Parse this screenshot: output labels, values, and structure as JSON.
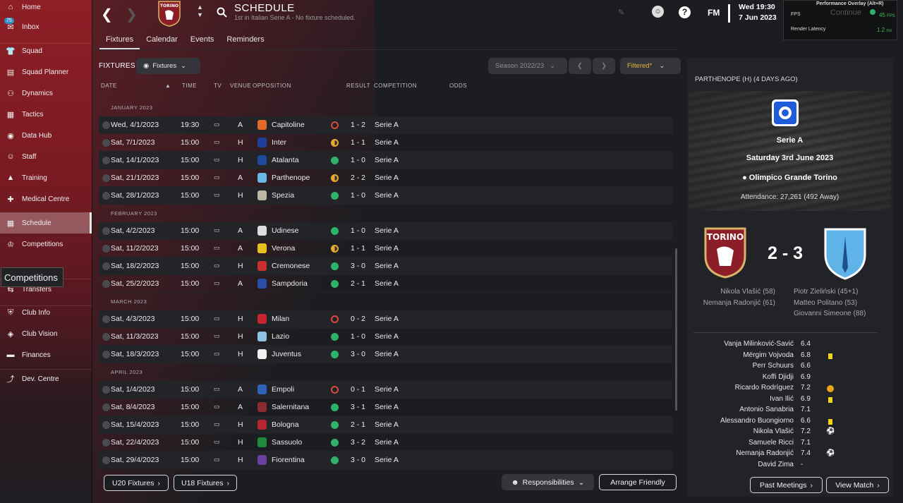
{
  "sidebar": {
    "items": [
      {
        "label": "Home",
        "icon": "home-icon"
      },
      {
        "label": "Inbox",
        "icon": "inbox-icon",
        "badge": "75"
      },
      {
        "label": "Squad",
        "icon": "shirt-icon"
      },
      {
        "label": "Squad Planner",
        "icon": "clipboard-icon"
      },
      {
        "label": "Dynamics",
        "icon": "people-icon"
      },
      {
        "label": "Tactics",
        "icon": "tactics-icon"
      },
      {
        "label": "Data Hub",
        "icon": "data-icon"
      },
      {
        "label": "Staff",
        "icon": "staff-icon"
      },
      {
        "label": "Training",
        "icon": "training-icon"
      },
      {
        "label": "Medical Centre",
        "icon": "medical-icon"
      },
      {
        "label": "Schedule",
        "icon": "calendar-icon"
      },
      {
        "label": "Competitions",
        "icon": "trophy-icon"
      },
      {
        "label": "Transfers",
        "icon": "transfer-icon"
      },
      {
        "label": "Club Info",
        "icon": "shield-icon"
      },
      {
        "label": "Club Vision",
        "icon": "vision-icon"
      },
      {
        "label": "Finances",
        "icon": "money-icon"
      },
      {
        "label": "Dev. Centre",
        "icon": "dev-icon"
      }
    ],
    "tooltip": "Competitions"
  },
  "header": {
    "title": "SCHEDULE",
    "subtitle": "1st in Italian Serie A - No fixture scheduled.",
    "datetime_top": "Wed 19:30",
    "datetime_bottom": "7 Jun 2023",
    "fm": "FM",
    "continue": "Continue"
  },
  "perf": {
    "title": "Performance Overlay (Alt+R)",
    "fps_label": "FPS",
    "fps_value": "45",
    "fps_unit": "FPS",
    "latency_label": "Render Latency",
    "latency_value": "1.2",
    "latency_unit": "ms"
  },
  "tabs": [
    "Fixtures",
    "Calendar",
    "Events",
    "Reminders"
  ],
  "fixtures_label": "FIXTURES",
  "fixtures_dropdown": "Fixtures",
  "season": "Season 2022/23",
  "filtered": "Filtered*",
  "columns": [
    "DATE",
    "TIME",
    "TV",
    "VENUE",
    "OPPOSITION",
    "RESULT",
    "COMPETITION",
    "ODDS"
  ],
  "months": [
    {
      "name": "JANUARY 2023",
      "rows": [
        {
          "date": "Wed, 4/1/2023",
          "time": "19:30",
          "venue": "A",
          "opp": "Capitoline",
          "res": "L",
          "score": "1 - 2",
          "comp": "Serie A",
          "color": "#e06a2a"
        },
        {
          "date": "Sat, 7/1/2023",
          "time": "15:00",
          "venue": "H",
          "opp": "Inter",
          "res": "D",
          "score": "1 - 1",
          "comp": "Serie A",
          "color": "#1e3f9a"
        },
        {
          "date": "Sat, 14/1/2023",
          "time": "15:00",
          "venue": "H",
          "opp": "Atalanta",
          "res": "W",
          "score": "1 - 0",
          "comp": "Serie A",
          "color": "#1d4a9b"
        },
        {
          "date": "Sat, 21/1/2023",
          "time": "15:00",
          "venue": "A",
          "opp": "Parthenope",
          "res": "D",
          "score": "2 - 2",
          "comp": "Serie A",
          "color": "#6bb8e8"
        },
        {
          "date": "Sat, 28/1/2023",
          "time": "15:00",
          "venue": "H",
          "opp": "Spezia",
          "res": "W",
          "score": "1 - 0",
          "comp": "Serie A",
          "color": "#bdb8a6"
        }
      ]
    },
    {
      "name": "FEBRUARY 2023",
      "rows": [
        {
          "date": "Sat, 4/2/2023",
          "time": "15:00",
          "venue": "A",
          "opp": "Udinese",
          "res": "W",
          "score": "1 - 0",
          "comp": "Serie A",
          "color": "#dddddd"
        },
        {
          "date": "Sat, 11/2/2023",
          "time": "15:00",
          "venue": "A",
          "opp": "Verona",
          "res": "D",
          "score": "1 - 1",
          "comp": "Serie A",
          "color": "#e8c21c"
        },
        {
          "date": "Sat, 18/2/2023",
          "time": "15:00",
          "venue": "H",
          "opp": "Cremonese",
          "res": "W",
          "score": "3 - 0",
          "comp": "Serie A",
          "color": "#c9302c"
        },
        {
          "date": "Sat, 25/2/2023",
          "time": "15:00",
          "venue": "A",
          "opp": "Sampdoria",
          "res": "W",
          "score": "2 - 1",
          "comp": "Serie A",
          "color": "#2a4fa8"
        }
      ]
    },
    {
      "name": "MARCH 2023",
      "rows": [
        {
          "date": "Sat, 4/3/2023",
          "time": "15:00",
          "venue": "H",
          "opp": "Milan",
          "res": "L",
          "score": "0 - 2",
          "comp": "Serie A",
          "color": "#c8242c"
        },
        {
          "date": "Sat, 11/3/2023",
          "time": "15:00",
          "venue": "H",
          "opp": "Lazio",
          "res": "W",
          "score": "1 - 0",
          "comp": "Serie A",
          "color": "#8fc3e6"
        },
        {
          "date": "Sat, 18/3/2023",
          "time": "15:00",
          "venue": "H",
          "opp": "Juventus",
          "res": "W",
          "score": "3 - 0",
          "comp": "Serie A",
          "color": "#f0f0f0"
        }
      ]
    },
    {
      "name": "APRIL 2023",
      "rows": [
        {
          "date": "Sat, 1/4/2023",
          "time": "15:00",
          "venue": "A",
          "opp": "Empoli",
          "res": "L",
          "score": "0 - 1",
          "comp": "Serie A",
          "color": "#2b64b8"
        },
        {
          "date": "Sat, 8/4/2023",
          "time": "15:00",
          "venue": "A",
          "opp": "Salernitana",
          "res": "W",
          "score": "3 - 1",
          "comp": "Serie A",
          "color": "#8b2a2f"
        },
        {
          "date": "Sat, 15/4/2023",
          "time": "15:00",
          "venue": "H",
          "opp": "Bologna",
          "res": "W",
          "score": "2 - 1",
          "comp": "Serie A",
          "color": "#b6262e"
        },
        {
          "date": "Sat, 22/4/2023",
          "time": "15:00",
          "venue": "H",
          "opp": "Sassuolo",
          "res": "W",
          "score": "3 - 2",
          "comp": "Serie A",
          "color": "#1f8a3a"
        },
        {
          "date": "Sat, 29/4/2023",
          "time": "15:00",
          "venue": "H",
          "opp": "Fiorentina",
          "res": "W",
          "score": "3 - 0",
          "comp": "Serie A",
          "color": "#6b3fa0"
        }
      ]
    }
  ],
  "buttons": {
    "u20": "U20 Fixtures",
    "u18": "U18 Fixtures",
    "resp": "Responsibilities",
    "friendly": "Arrange Friendly",
    "past": "Past Meetings",
    "view": "View Match"
  },
  "panel": {
    "header": "PARTHENOPE (H) (4 DAYS AGO)",
    "comp": "Serie A",
    "date": "Saturday 3rd June 2023",
    "stadium": "Olimpico Grande Torino",
    "attendance": "Attendance: 27,261 (492 Away)",
    "score": "2 - 3",
    "home_scorers": [
      "Nikola Vlašić (58)",
      "Nemanja Radonjić (61)"
    ],
    "away_scorers": [
      "Piotr Zieliński (45+1)",
      "Matteo Politano (53)",
      "Giovanni Simeone (88)"
    ],
    "players": [
      {
        "name": "Vanja Milinković-Savić",
        "rating": "6.4",
        "icon": ""
      },
      {
        "name": "Mërgim Vojvoda",
        "rating": "6.8",
        "icon": "yellow"
      },
      {
        "name": "Perr Schuurs",
        "rating": "6.6",
        "icon": ""
      },
      {
        "name": "Koffi Djidji",
        "rating": "6.9",
        "icon": ""
      },
      {
        "name": "Ricardo Rodríguez",
        "rating": "7.2",
        "icon": "assist"
      },
      {
        "name": "Ivan Ilić",
        "rating": "6.9",
        "icon": "yellow"
      },
      {
        "name": "Antonio Sanabria",
        "rating": "7.1",
        "icon": ""
      },
      {
        "name": "Alessandro Buongiorno",
        "rating": "6.6",
        "icon": "yellow"
      },
      {
        "name": "Nikola Vlašić",
        "rating": "7.2",
        "icon": "ball"
      },
      {
        "name": "Samuele Ricci",
        "rating": "7.1",
        "icon": ""
      },
      {
        "name": "Nemanja Radonjić",
        "rating": "7.4",
        "icon": "ball"
      },
      {
        "name": "David Zima",
        "rating": "-",
        "icon": ""
      }
    ]
  }
}
